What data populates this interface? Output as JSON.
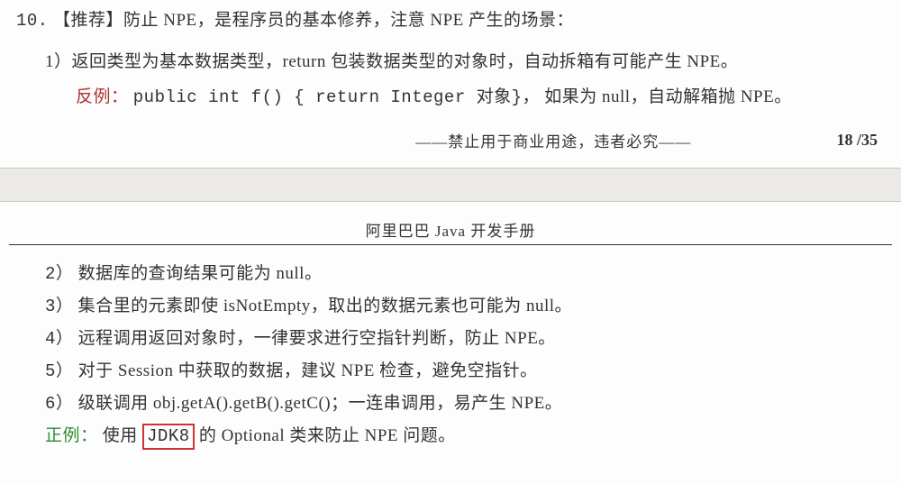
{
  "rule": {
    "number": "10.",
    "tag": "【推荐】",
    "headline_rest": "防止 NPE，是程序员的基本修养，注意 NPE 产生的场景：",
    "item1": "1）返回类型为基本数据类型，return 包装数据类型的对象时，自动拆箱有可能产生 NPE。",
    "counter_label": "反例：",
    "counter_code": "public int f() { return Integer 对象}，",
    "counter_tail": " 如果为 null，自动解箱抛 NPE。"
  },
  "footer": {
    "center": "——禁止用于商业用途，违者必究——",
    "page": "18 /35"
  },
  "doc_title": "阿里巴巴 Java 开发手册",
  "items": {
    "i2_num": "2）",
    "i2_text": " 数据库的查询结果可能为 null。",
    "i3_num": "3）",
    "i3_text": " 集合里的元素即使 isNotEmpty，取出的数据元素也可能为 null。",
    "i4_num": "4）",
    "i4_text": " 远程调用返回对象时，一律要求进行空指针判断，防止 NPE。",
    "i5_num": "5）",
    "i5_text": " 对于 Session 中获取的数据，建议 NPE 检查，避免空指针。",
    "i6_num": "6）",
    "i6_text": " 级联调用 obj.getA().getB().getC()；一连串调用，易产生 NPE。"
  },
  "positive": {
    "label": "正例：",
    "before": "使用 ",
    "highlight": "JDK8",
    "after": " 的 Optional 类来防止 NPE 问题。"
  }
}
